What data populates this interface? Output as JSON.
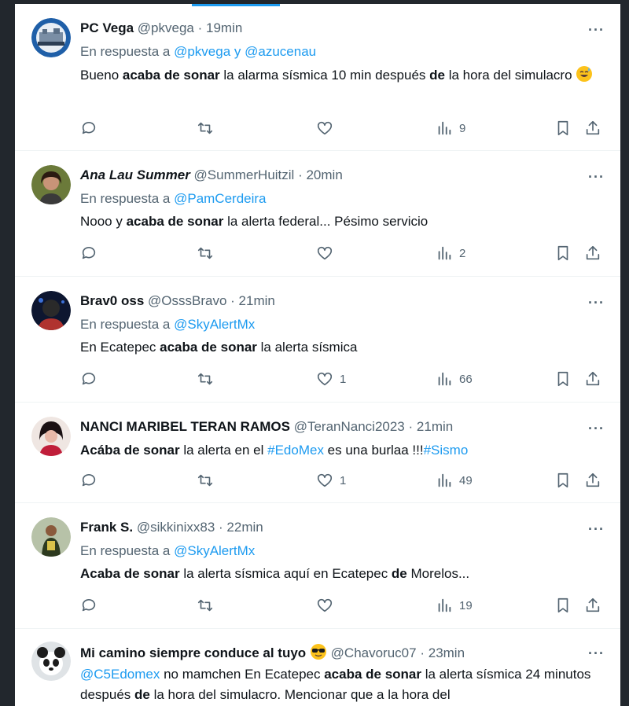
{
  "tweets": [
    {
      "name": "PC Vega",
      "handle": "@pkvega",
      "time": "19min",
      "reply_prefix": "En respuesta a",
      "reply_mentions": "@pkvega y @azucenau",
      "text_parts": [
        "Bueno ",
        "acaba de sonar",
        " la alarma sísmica 10 min después ",
        "de",
        " la hora del simulacro "
      ],
      "emoji": "sweat-smile",
      "views": "9",
      "likes": ""
    },
    {
      "name": "Ana Lau Summer",
      "handle": "@SummerHuitzil",
      "time": "20min",
      "reply_prefix": "En respuesta a",
      "reply_mentions": "@PamCerdeira",
      "text_parts": [
        "Nooo y ",
        "acaba de sonar",
        " la alerta federal... Pésimo servicio"
      ],
      "views": "2",
      "likes": ""
    },
    {
      "name": "Brav0 oss",
      "handle": "@OsssBravo",
      "time": "21min",
      "reply_prefix": "En respuesta a",
      "reply_mentions": "@SkyAlertMx",
      "text_parts": [
        "En Ecatepec ",
        "acaba de sonar",
        " la alerta sísmica"
      ],
      "views": "66",
      "likes": "1"
    },
    {
      "name": "NANCI MARIBEL TERAN RAMOS",
      "handle": "@TeranNanci2023",
      "time": "21min",
      "text_parts": [
        "Acába de sonar",
        " la alerta en el ",
        "#EdoMex",
        " es una burlaa !!!",
        "#Sismo"
      ],
      "views": "49",
      "likes": "1"
    },
    {
      "name": "Frank S.",
      "handle": "@sikkinixx83",
      "time": "22min",
      "reply_prefix": "En respuesta a",
      "reply_mentions": "@SkyAlertMx",
      "text_parts": [
        "Acaba de sonar",
        " la alerta sísmica aquí en Ecatepec ",
        "de",
        " Morelos..."
      ],
      "views": "19",
      "likes": ""
    },
    {
      "name": "Mi camino siempre conduce al tuyo",
      "name_emoji": "sunglasses",
      "handle": "@Chavoruc07",
      "time": "23min",
      "text_parts": [
        "@C5Edomex",
        " no mamchen En Ecatepec ",
        "acaba de sonar",
        " la alerta sísmica 24 minutos después ",
        "de",
        " la hora del simulacro. Mencionar que a la hora del"
      ]
    }
  ],
  "dot": "·",
  "more_label": "···",
  "colors": {
    "accent": "#1d9bf0",
    "muted": "#536471",
    "text": "#0f1419",
    "frame": "#22272d"
  },
  "icons": [
    "reply-icon",
    "retweet-icon",
    "like-icon",
    "views-icon",
    "bookmark-icon",
    "share-icon",
    "more-icon"
  ]
}
